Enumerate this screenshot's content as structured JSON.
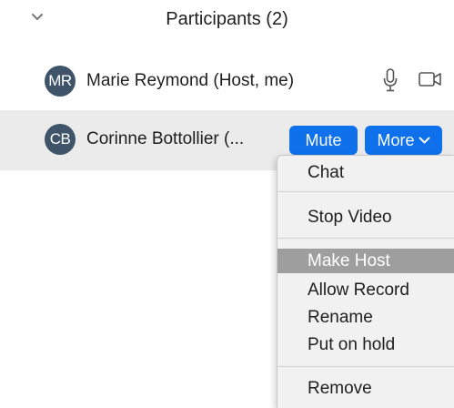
{
  "header": {
    "title": "Participants (2)",
    "chevron_icon": "chevron-down-icon"
  },
  "participants": [
    {
      "initials": "MR",
      "name": "Marie Reymond (Host, me)",
      "avatar_color": "#3f5468",
      "icons": [
        "microphone-icon",
        "video-camera-icon"
      ]
    },
    {
      "initials": "CB",
      "name": "Corinne Bottollier (...",
      "avatar_color": "#3f5468",
      "mute_label": "Mute",
      "more_label": "More"
    }
  ],
  "menu": {
    "items": [
      "Chat",
      "Stop Video",
      "Make Host",
      "Allow Record",
      "Rename",
      "Put on hold",
      "Remove"
    ],
    "highlighted": "Make Host"
  },
  "colors": {
    "accent": "#0e71eb",
    "selected_row": "#ebebeb",
    "menu_highlight": "#9e9e9e"
  }
}
